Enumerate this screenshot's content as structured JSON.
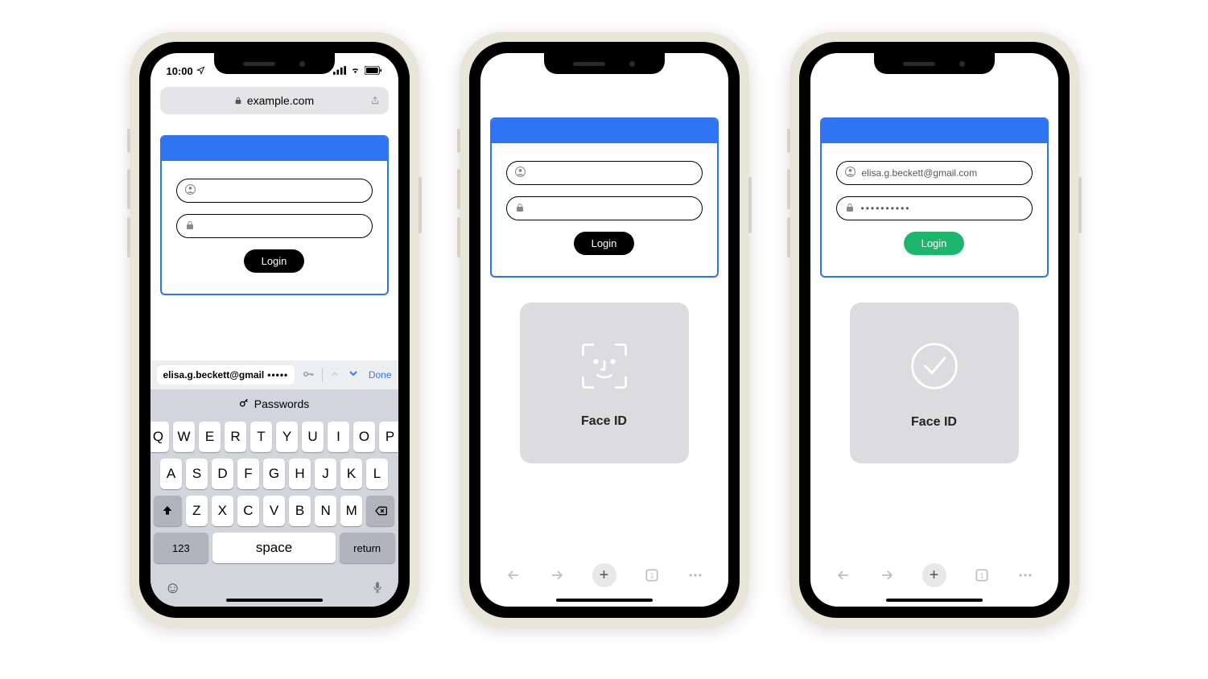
{
  "status": {
    "time": "10:00"
  },
  "addr": {
    "domain": "example.com"
  },
  "login": {
    "button_label": "Login"
  },
  "phone3": {
    "email": "elisa.g.beckett@gmail.com",
    "password_masked": "••••••••••"
  },
  "suggestion": {
    "email": "elisa.g.beckett@gmail",
    "dots": "•••••",
    "done": "Done"
  },
  "passwords_label": "Passwords",
  "keyboard": {
    "row1": [
      "Q",
      "W",
      "E",
      "R",
      "T",
      "Y",
      "U",
      "I",
      "O",
      "P"
    ],
    "row2": [
      "A",
      "S",
      "D",
      "F",
      "G",
      "H",
      "J",
      "K",
      "L"
    ],
    "row3": [
      "Z",
      "X",
      "C",
      "V",
      "B",
      "N",
      "M"
    ],
    "num": "123",
    "space": "space",
    "return": "return"
  },
  "faceid": {
    "label": "Face ID"
  },
  "toolbar": {
    "tab_count": "1"
  }
}
